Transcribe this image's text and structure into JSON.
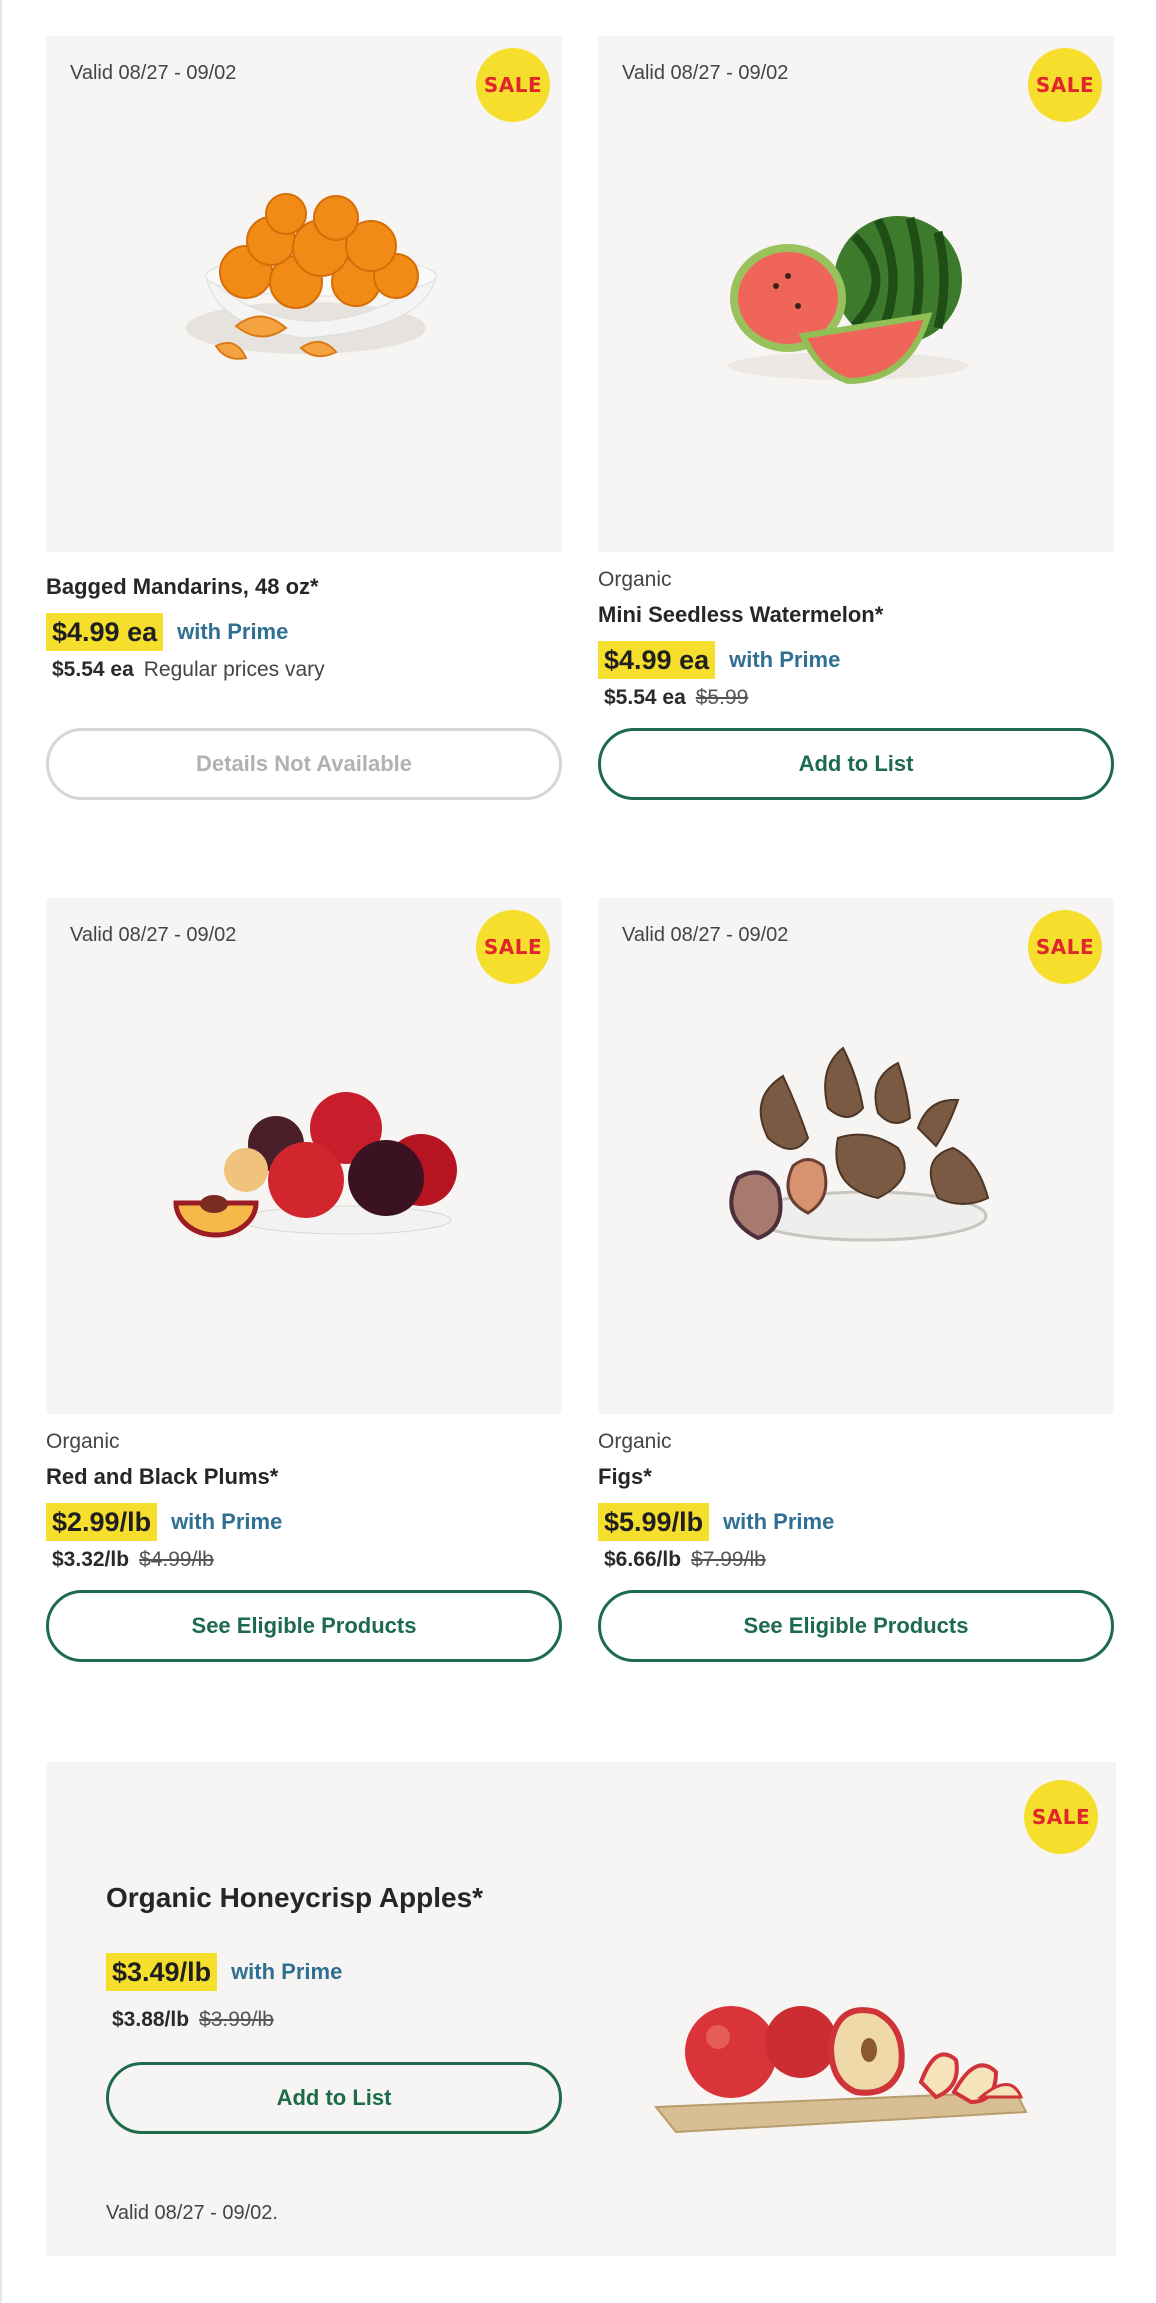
{
  "cards": [
    {
      "valid": "Valid 08/27 - 09/02",
      "sale_badge": "SALE",
      "organic": "",
      "title": "Bagged Mandarins, 48 oz*",
      "sale_price": "$4.99 ea",
      "prime_label": "with Prime",
      "nonprime_price": "$5.54 ea",
      "regular_price": "",
      "note": "Regular prices vary",
      "button": "Details Not Available",
      "button_enabled": false,
      "image_icon": "mandarins-icon"
    },
    {
      "valid": "Valid 08/27 - 09/02",
      "sale_badge": "SALE",
      "organic": "Organic",
      "title": "Mini Seedless Watermelon*",
      "sale_price": "$4.99 ea",
      "prime_label": "with Prime",
      "nonprime_price": "$5.54 ea",
      "regular_price": "$5.99",
      "note": "",
      "button": "Add to List",
      "button_enabled": true,
      "image_icon": "watermelon-icon"
    },
    {
      "valid": "Valid 08/27 - 09/02",
      "sale_badge": "SALE",
      "organic": "Organic",
      "title": "Red and Black Plums*",
      "sale_price": "$2.99/lb",
      "prime_label": "with Prime",
      "nonprime_price": "$3.32/lb",
      "regular_price": "$4.99/lb",
      "note": "",
      "button": "See Eligible Products",
      "button_enabled": true,
      "image_icon": "plums-icon"
    },
    {
      "valid": "Valid 08/27 - 09/02",
      "sale_badge": "SALE",
      "organic": "Organic",
      "title": "Figs*",
      "sale_price": "$5.99/lb",
      "prime_label": "with Prime",
      "nonprime_price": "$6.66/lb",
      "regular_price": "$7.99/lb",
      "note": "",
      "button": "See Eligible Products",
      "button_enabled": true,
      "image_icon": "figs-icon"
    }
  ],
  "feature": {
    "sale_badge": "SALE",
    "title": "Organic Honeycrisp Apples*",
    "sale_price": "$3.49/lb",
    "prime_label": "with Prime",
    "nonprime_price": "$3.88/lb",
    "regular_price": "$3.99/lb",
    "button": "Add to List",
    "valid": "Valid 08/27 - 09/02.",
    "image_icon": "apples-icon"
  },
  "colors": {
    "sale_yellow": "#f6df2c",
    "sale_red": "#e0262b",
    "prime_blue": "#2f6f93",
    "button_green": "#1d6b4c",
    "card_bg": "#f7f5f3"
  }
}
